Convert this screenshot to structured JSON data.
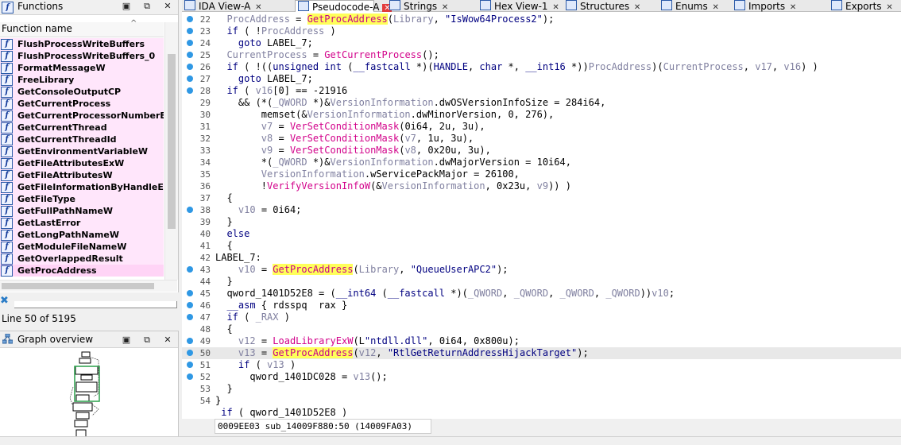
{
  "functions_panel": {
    "title": "Functions",
    "column_header": "Function name",
    "items": [
      "FlushProcessWriteBuffers",
      "FlushProcessWriteBuffers_0",
      "FormatMessageW",
      "FreeLibrary",
      "GetConsoleOutputCP",
      "GetCurrentProcess",
      "GetCurrentProcessorNumberEx",
      "GetCurrentThread",
      "GetCurrentThreadId",
      "GetEnvironmentVariableW",
      "GetFileAttributesExW",
      "GetFileAttributesW",
      "GetFileInformationByHandleEx",
      "GetFileType",
      "GetFullPathNameW",
      "GetLastError",
      "GetLongPathNameW",
      "GetModuleFileNameW",
      "GetOverlappedResult",
      "GetProcAddress"
    ],
    "selected_item": "GetProcAddress",
    "line_status": "Line 50 of 5195"
  },
  "graph_panel": {
    "title": "Graph overview"
  },
  "tabs": [
    {
      "label": "IDA View-A",
      "icon": "ida-view-icon",
      "active": false
    },
    {
      "label": "Pseudocode-A",
      "icon": "pseudocode-icon",
      "active": true
    },
    {
      "label": "Strings",
      "icon": "strings-icon",
      "active": false
    },
    {
      "label": "Hex View-1",
      "icon": "hex-view-icon",
      "active": false
    },
    {
      "label": "Structures",
      "icon": "structures-icon",
      "active": false
    },
    {
      "label": "Enums",
      "icon": "enums-icon",
      "active": false
    },
    {
      "label": "Imports",
      "icon": "imports-icon",
      "active": false
    },
    {
      "label": "Exports",
      "icon": "exports-icon",
      "active": false
    }
  ],
  "code": {
    "current_line": 50,
    "lines": [
      {
        "n": "22",
        "bp": true,
        "html": "  <span class=\"g\">ProcAddress</span> = <span class=\"hl\">GetProcAddress</span>(<span class=\"g\">Library</span>, <span class=\"str\">\"IsWow64Process2\"</span>);"
      },
      {
        "n": "23",
        "bp": true,
        "html": "  <span class=\"kw\">if</span> ( !<span class=\"g\">ProcAddress</span> )"
      },
      {
        "n": "24",
        "bp": true,
        "html": "    <span class=\"kw\">goto</span> LABEL_7;"
      },
      {
        "n": "25",
        "bp": true,
        "html": "  <span class=\"g\">CurrentProcess</span> = <span class=\"fc\">GetCurrentProcess</span>();"
      },
      {
        "n": "26",
        "bp": true,
        "html": "  <span class=\"kw\">if</span> ( !((<span class=\"kw\">unsigned int</span> (<span class=\"kw\">__fastcall</span> *)(<span class=\"kw\">HANDLE</span>, <span class=\"kw\">char</span> *, <span class=\"kw\">__int16</span> *))<span class=\"g\">ProcAddress</span>)(<span class=\"g\">CurrentProcess</span>, <span class=\"g\">v17</span>, <span class=\"g\">v16</span>) )"
      },
      {
        "n": "27",
        "bp": true,
        "html": "    <span class=\"kw\">goto</span> LABEL_7;"
      },
      {
        "n": "28",
        "bp": true,
        "html": "  <span class=\"kw\">if</span> ( <span class=\"g\">v16</span>[0] == -21916"
      },
      {
        "n": "29",
        "bp": false,
        "html": "    &amp;&amp; (*(<span class=\"g\">_QWORD</span> *)&amp;<span class=\"g\">VersionInformation</span>.dwOSVersionInfoSize = 284i64,"
      },
      {
        "n": "30",
        "bp": false,
        "html": "        memset(&amp;<span class=\"g\">VersionInformation</span>.dwMinorVersion, 0, 276),"
      },
      {
        "n": "31",
        "bp": false,
        "html": "        <span class=\"g\">v7</span> = <span class=\"fc\">VerSetConditionMask</span>(0i64, 2u, 3u),"
      },
      {
        "n": "32",
        "bp": false,
        "html": "        <span class=\"g\">v8</span> = <span class=\"fc\">VerSetConditionMask</span>(<span class=\"g\">v7</span>, 1u, 3u),"
      },
      {
        "n": "33",
        "bp": false,
        "html": "        <span class=\"g\">v9</span> = <span class=\"fc\">VerSetConditionMask</span>(<span class=\"g\">v8</span>, 0x20u, 3u),"
      },
      {
        "n": "34",
        "bp": false,
        "html": "        *(<span class=\"g\">_QWORD</span> *)&amp;<span class=\"g\">VersionInformation</span>.dwMajorVersion = 10i64,"
      },
      {
        "n": "35",
        "bp": false,
        "html": "        <span class=\"g\">VersionInformation</span>.wServicePackMajor = 26100,"
      },
      {
        "n": "36",
        "bp": false,
        "html": "        !<span class=\"fc\">VerifyVersionInfoW</span>(&amp;<span class=\"g\">VersionInformation</span>, 0x23u, <span class=\"g\">v9</span>)) )"
      },
      {
        "n": "37",
        "bp": false,
        "html": "  {"
      },
      {
        "n": "38",
        "bp": true,
        "html": "    <span class=\"g\">v10</span> = 0i64;"
      },
      {
        "n": "39",
        "bp": false,
        "html": "  }"
      },
      {
        "n": "40",
        "bp": false,
        "html": "  <span class=\"kw\">else</span>"
      },
      {
        "n": "41",
        "bp": false,
        "html": "  {"
      },
      {
        "n": "42",
        "bp": false,
        "html": "LABEL_7:"
      },
      {
        "n": "43",
        "bp": true,
        "html": "    <span class=\"g\">v10</span> = <span class=\"hl\">GetProcAddress</span>(<span class=\"g\">Library</span>, <span class=\"str\">\"QueueUserAPC2\"</span>);"
      },
      {
        "n": "44",
        "bp": false,
        "html": "  }"
      },
      {
        "n": "45",
        "bp": true,
        "html": "  qword_1401D52E8 = (<span class=\"kw\">__int64</span> (<span class=\"kw\">__fastcall</span> *)(<span class=\"g\">_QWORD</span>, <span class=\"g\">_QWORD</span>, <span class=\"g\">_QWORD</span>, <span class=\"g\">_QWORD</span>))<span class=\"g\">v10</span>;"
      },
      {
        "n": "46",
        "bp": true,
        "html": "  <span class=\"kw\">__asm</span> { rdsspq  rax }"
      },
      {
        "n": "47",
        "bp": true,
        "html": "  <span class=\"kw\">if</span> ( <span class=\"g\">_RAX</span> )"
      },
      {
        "n": "48",
        "bp": false,
        "html": "  {"
      },
      {
        "n": "49",
        "bp": true,
        "html": "    <span class=\"g\">v12</span> = <span class=\"fc\">LoadLibraryExW</span>(L<span class=\"str\">\"ntdll.dll\"</span>, 0i64, 0x800u);"
      },
      {
        "n": "50",
        "bp": true,
        "html": "    <span class=\"g\">v13</span> = <span class=\"hl\">GetProcAddress</span>(<span class=\"g\">v12</span>, <span class=\"str\">\"RtlGetReturnAddressHijackTarget\"</span>);"
      },
      {
        "n": "51",
        "bp": true,
        "html": "    <span class=\"kw\">if</span> ( <span class=\"g\">v13</span> )"
      },
      {
        "n": "52",
        "bp": true,
        "html": "      qword_1401DC028 = <span class=\"g\">v13</span>();"
      },
      {
        "n": "53",
        "bp": false,
        "html": "  }"
      },
      {
        "n": "54",
        "bp": false,
        "html": "}"
      },
      {
        "n": "",
        "bp": false,
        "html": " <span class=\"kw\">if</span> ( qword_1401D52E8 )"
      }
    ],
    "status": "0009EE03 sub_14009F880:50 (14009FA03)"
  },
  "colors": {
    "function_row_bg": "#ffe6fb",
    "breakpoint_dot": "#2f98e4",
    "highlight_bg": "#ffff5a",
    "active_tab_close": "#e23b3b"
  }
}
